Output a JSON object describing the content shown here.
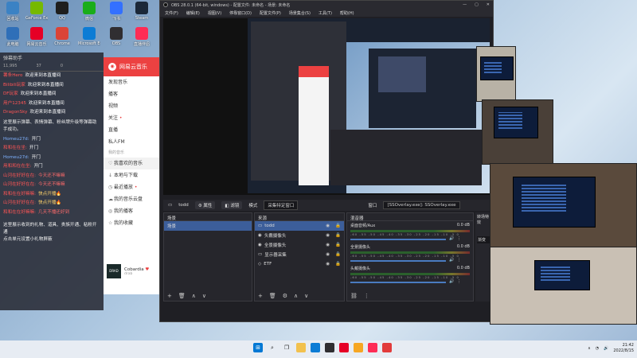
{
  "desktop": {
    "icons": [
      {
        "label": "回收站",
        "color": "#3b82c4"
      },
      {
        "label": "GeForce Experience",
        "color": "#76b900"
      },
      {
        "label": "QQ",
        "color": "#1e1e1e"
      },
      {
        "label": "微信",
        "color": "#1aad19"
      },
      {
        "label": "飞书",
        "color": "#3370ff"
      },
      {
        "label": "Steam",
        "color": "#1b2838"
      },
      {
        "label": "此电脑",
        "color": "#2f6fb8"
      },
      {
        "label": "网易云音乐",
        "color": "#e60026"
      },
      {
        "label": "Chrome",
        "color": "#db4437"
      },
      {
        "label": "Microsoft Edge",
        "color": "#0c7cd5"
      },
      {
        "label": "OBS",
        "color": "#302e31"
      },
      {
        "label": "直播伴侣",
        "color": "#fe2c55"
      }
    ]
  },
  "chat": {
    "header": "弹幕助手",
    "stats": [
      "11,995",
      "37",
      "0"
    ],
    "messages": [
      {
        "name": "薯条Hero",
        "text": "欢迎来到本直播间",
        "name_color": "red",
        "text_color": ""
      },
      {
        "name": "Bilibili玩家",
        "text": "欢迎来到本直播间",
        "name_color": "red",
        "text_color": ""
      },
      {
        "name": "DF玩家",
        "text": "欢迎来到本直播间",
        "name_color": "red",
        "text_color": ""
      },
      {
        "name": "用户12345",
        "text": "欢迎来到本直播间",
        "name_color": "red",
        "text_color": ""
      },
      {
        "name": "DragonSky",
        "text": "欢迎来到本直播间",
        "name_color": "red",
        "text_color": ""
      }
    ],
    "notice1": "这里展示弹幕、表情弹幕、粉丝牌升级等弹幕助手成功。",
    "messages2": [
      {
        "name": "Homeu27d:",
        "text": "开门",
        "name_color": "blue",
        "text_color": ""
      },
      {
        "name": "和和在在坐:",
        "text": "开门",
        "name_color": "red",
        "text_color": ""
      },
      {
        "name": "Homeu27d:",
        "text": "开门",
        "name_color": "blue",
        "text_color": ""
      },
      {
        "name": "用和和在在坐:",
        "text": "开门",
        "name_color": "red",
        "text_color": ""
      },
      {
        "name": "山河在好好在在:",
        "text": "今天还不嘛嘛",
        "name_color": "red",
        "text_color": "r"
      },
      {
        "name": "山河在好好在在:",
        "text": "今天还不嘛嘛",
        "name_color": "red",
        "text_color": "r"
      },
      {
        "name": "和和在在好嘛嘛:",
        "text": "快点开播🔥",
        "name_color": "red",
        "text_color": "y"
      },
      {
        "name": "山河在好好在在:",
        "text": "快点开播🔥",
        "name_color": "red",
        "text_color": "y"
      },
      {
        "name": "和和在在好嘛嘛:",
        "text": "几天不播还好到",
        "name_color": "red",
        "text_color": "r"
      }
    ],
    "notice2": "这里展示收到的礼物、道具、贵族开通、粘粉开通\n点击单元设置小礼物屏蔽"
  },
  "music": {
    "app_name": "网易云音乐",
    "nav": [
      {
        "label": "发现音乐",
        "icon": "",
        "sub": false,
        "active": false,
        "dot": false
      },
      {
        "label": "播客",
        "icon": "",
        "sub": false,
        "active": false,
        "dot": false
      },
      {
        "label": "视频",
        "icon": "",
        "sub": false,
        "active": false,
        "dot": false
      },
      {
        "label": "关注",
        "icon": "",
        "sub": false,
        "active": false,
        "dot": true
      },
      {
        "label": "直播",
        "icon": "",
        "sub": false,
        "active": false,
        "dot": false
      },
      {
        "label": "私人FM",
        "icon": "",
        "sub": false,
        "active": false,
        "dot": false
      },
      {
        "label": "我的音乐",
        "icon": "",
        "sub": true,
        "active": false,
        "dot": false
      },
      {
        "label": "我喜欢的音乐",
        "icon": "♡",
        "sub": false,
        "active": true,
        "dot": false
      },
      {
        "label": "本地与下载",
        "icon": "↓",
        "sub": false,
        "active": false,
        "dot": false
      },
      {
        "label": "最近播放",
        "icon": "◷",
        "sub": false,
        "active": false,
        "dot": true
      },
      {
        "label": "我的音乐云盘",
        "icon": "☁",
        "sub": false,
        "active": false,
        "dot": false
      },
      {
        "label": "我的播客",
        "icon": "◎",
        "sub": false,
        "active": false,
        "dot": false
      },
      {
        "label": "我的收藏",
        "icon": "☆",
        "sub": false,
        "active": false,
        "dot": false
      }
    ],
    "user": {
      "avatar_text": "DRAD",
      "name": "Cobardia",
      "sub": "drab"
    }
  },
  "obs": {
    "title": "OBS 28.0.1 (64-bit, windows) - 配置文件: 未命名 - 场景: 未命名",
    "menu": [
      "文件(F)",
      "编辑(E)",
      "视图(V)",
      "停靠窗口(D)",
      "配置文件(P)",
      "场景集合(S)",
      "工具(T)",
      "帮助(H)"
    ],
    "controls": {
      "source_name": "todd",
      "props": "属性",
      "filters": "滤镜",
      "mode_label": "模式",
      "mode_value": "采集特定窗口",
      "window_label": "窗口",
      "window_value": "[SSOverlay.exe]: SSOverlay.exe"
    },
    "scenes": {
      "title": "场景",
      "items": [
        "场景"
      ]
    },
    "sources": {
      "title": "来源",
      "items": [
        {
          "label": "todd",
          "icon": "▭",
          "selected": true
        },
        {
          "label": "头戴摄像头",
          "icon": "◉",
          "selected": false
        },
        {
          "label": "全景摄像头",
          "icon": "◉",
          "selected": false
        },
        {
          "label": "显示器采集",
          "icon": "▭",
          "selected": false
        },
        {
          "label": "ETF",
          "icon": "◇",
          "selected": false
        }
      ]
    },
    "mixer": {
      "title": "混音器",
      "tracks": [
        {
          "name": "桌面音频/Aux",
          "db": "0.0 dB"
        },
        {
          "name": "全景摄像头",
          "db": "0.0 dB"
        },
        {
          "name": "头戴摄像头",
          "db": "0.0 dB"
        }
      ],
      "ticks": "-60 -55 -50 -45 -40 -35 -30 -25 -20 -15 -10 -5 0"
    },
    "transitions": {
      "title": "转场特效",
      "label": "渐变"
    }
  },
  "taskbar": {
    "time": "21:42",
    "date": "2022/8/15"
  }
}
